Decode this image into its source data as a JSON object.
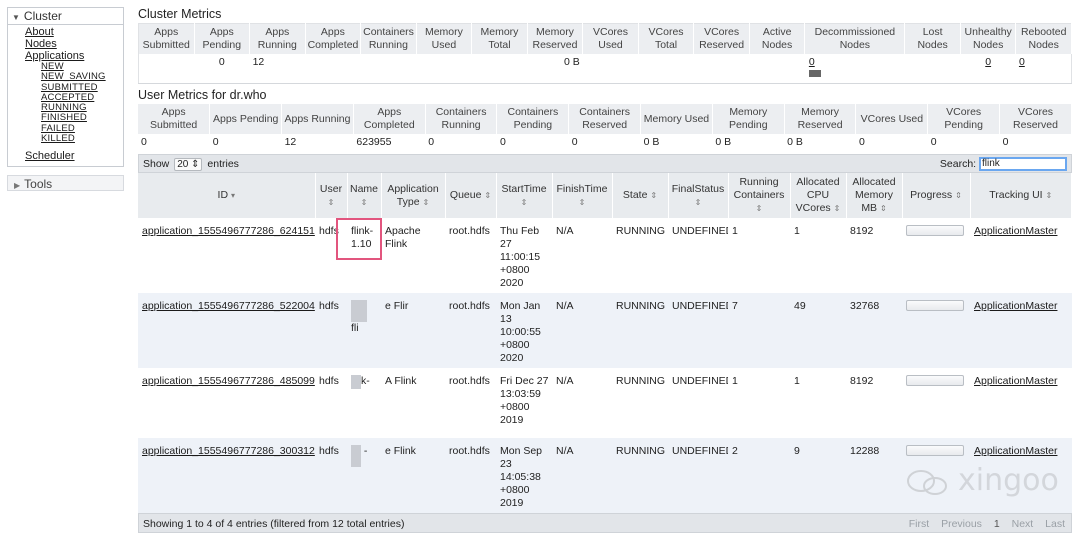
{
  "sidebar": {
    "cluster_label": "Cluster",
    "links": [
      "About",
      "Nodes",
      "Applications"
    ],
    "app_states": [
      "NEW",
      "NEW_SAVING",
      "SUBMITTED",
      "ACCEPTED",
      "RUNNING",
      "FINISHED",
      "FAILED",
      "KILLED"
    ],
    "scheduler": "Scheduler",
    "tools": "Tools"
  },
  "cluster_metrics": {
    "title": "Cluster Metrics",
    "headers": [
      "Apps Submitted",
      "Apps Pending",
      "Apps Running",
      "Apps Completed",
      "Containers Running",
      "Memory Used",
      "Memory Total",
      "Memory Reserved",
      "VCores Used",
      "VCores Total",
      "VCores Reserved",
      "Active Nodes",
      "Decommissioned Nodes",
      "Lost Nodes",
      "Unhealthy Nodes",
      "Rebooted Nodes"
    ],
    "values": [
      "",
      "0",
      "12",
      "",
      "",
      "",
      "",
      "0 B",
      "",
      "",
      "",
      "",
      "0",
      "",
      "0",
      "0"
    ]
  },
  "user_metrics": {
    "title": "User Metrics for dr.who",
    "headers": [
      "Apps Submitted",
      "Apps Pending",
      "Apps Running",
      "Apps Completed",
      "Containers Running",
      "Containers Pending",
      "Containers Reserved",
      "Memory Used",
      "Memory Pending",
      "Memory Reserved",
      "VCores Used",
      "VCores Pending",
      "VCores Reserved"
    ],
    "values": [
      "0",
      "0",
      "12",
      "623955",
      "0",
      "0",
      "0",
      "0 B",
      "0 B",
      "0 B",
      "0",
      "0",
      "0"
    ]
  },
  "toolbar": {
    "show_label": "Show",
    "entries_value": "20",
    "entries_label": "entries",
    "search_label": "Search:",
    "search_value": "flink"
  },
  "apps_table": {
    "headers": [
      "ID",
      "User",
      "Name",
      "Application Type",
      "Queue",
      "StartTime",
      "FinishTime",
      "State",
      "FinalStatus",
      "Running Containers",
      "Allocated CPU VCores",
      "Allocated Memory MB",
      "Progress",
      "Tracking UI"
    ],
    "rows": [
      {
        "id": "application_1555496777286_624151",
        "user": "hdfs",
        "name": "flink-1.10",
        "type": "Apache Flink",
        "queue": "root.hdfs",
        "start": "Thu Feb 27 11:00:15 +0800 2020",
        "finish": "N/A",
        "state": "RUNNING",
        "final": "UNDEFINED",
        "containers": "1",
        "vcores": "1",
        "memory": "8192",
        "tracking": "ApplicationMaster"
      },
      {
        "id": "application_1555496777286_522004",
        "user": "hdfs",
        "name": "fli",
        "type": "e Flir",
        "queue": "root.hdfs",
        "start": "Mon Jan 13 10:00:55 +0800 2020",
        "finish": "N/A",
        "state": "RUNNING",
        "final": "UNDEFINED",
        "containers": "7",
        "vcores": "49",
        "memory": "32768",
        "tracking": "ApplicationMaster"
      },
      {
        "id": "application_1555496777286_485099",
        "user": "hdfs",
        "name": "k-",
        "type": "A Flink",
        "queue": "root.hdfs",
        "start": "Fri Dec 27 13:03:59 +0800 2019",
        "finish": "N/A",
        "state": "RUNNING",
        "final": "UNDEFINED",
        "containers": "1",
        "vcores": "1",
        "memory": "8192",
        "tracking": "ApplicationMaster"
      },
      {
        "id": "application_1555496777286_300312",
        "user": "hdfs",
        "name": "-",
        "type": "e Flink",
        "queue": "root.hdfs",
        "start": "Mon Sep 23 14:05:38 +0800 2019",
        "finish": "N/A",
        "state": "RUNNING",
        "final": "UNDEFINED",
        "containers": "2",
        "vcores": "9",
        "memory": "12288",
        "tracking": "ApplicationMaster"
      }
    ]
  },
  "footer": {
    "info": "Showing 1 to 4 of 4 entries (filtered from 12 total entries)",
    "first": "First",
    "previous": "Previous",
    "page": "1",
    "next": "Next",
    "last": "Last"
  },
  "watermark": "xingoo",
  "colors": {
    "highlight_box": "#e2557e",
    "search_focus": "#6aa7f0",
    "header_bg": "#e8ebee",
    "row_alt": "#eef2f8"
  }
}
